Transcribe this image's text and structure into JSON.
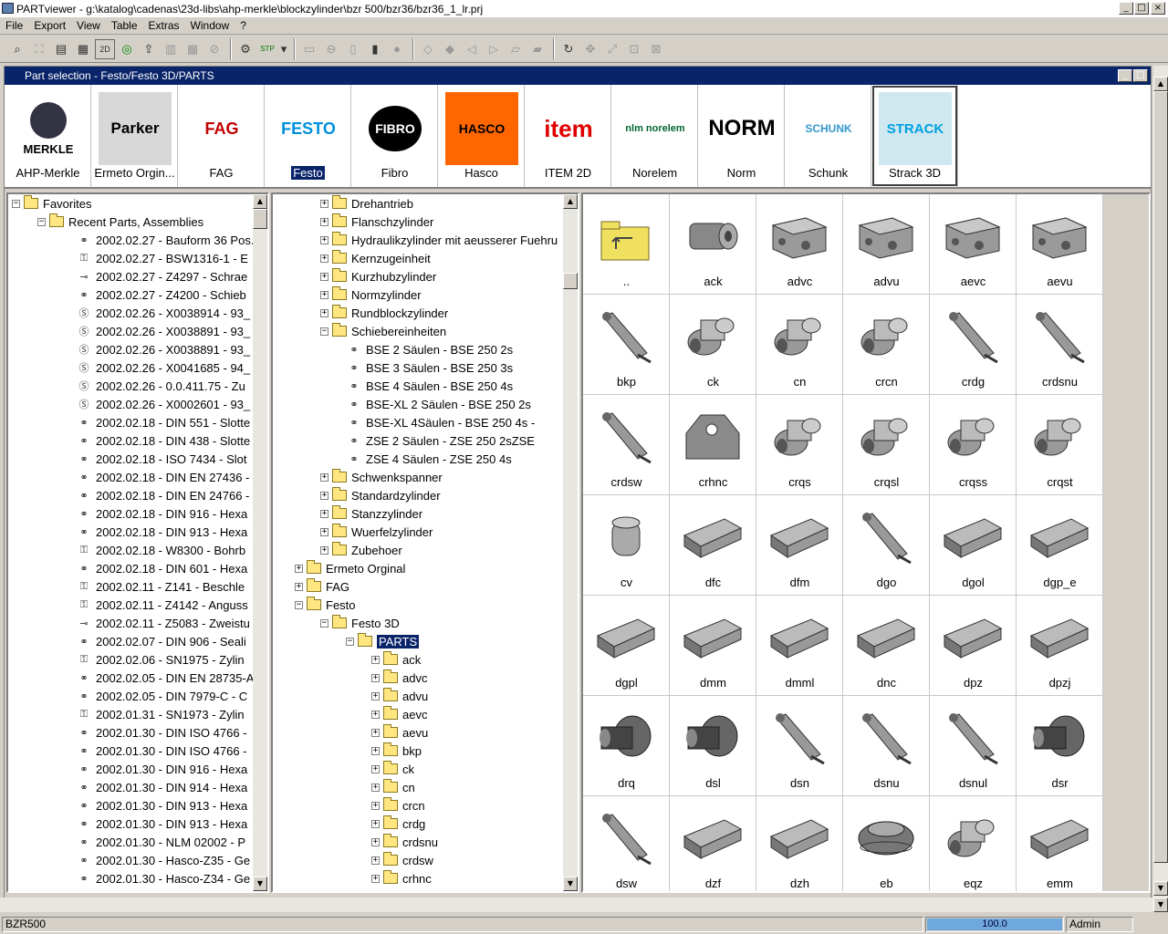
{
  "window": {
    "title": "PARTviewer - g:\\katalog\\cadenas\\23d-libs\\ahp-merkle\\blockzylinder\\bzr 500/bzr36/bzr36_1_lr.prj"
  },
  "menu": [
    "File",
    "Export",
    "View",
    "Table",
    "Extras",
    "Window",
    "?"
  ],
  "toolbar": {
    "icon_2d": "2D",
    "icon_stp": "STP"
  },
  "part_selection": {
    "title": "Part selection  -  Festo/Festo 3D/PARTS"
  },
  "catalogs": [
    {
      "label": "AHP-Merkle",
      "logo": "MERKLE",
      "color": "#000000"
    },
    {
      "label": "Ermeto Orgin...",
      "logo": "Parker",
      "color": "#000000"
    },
    {
      "label": "FAG",
      "logo": "FAG",
      "color": "#c00000"
    },
    {
      "label": "Festo",
      "logo": "FESTO",
      "color": "#0091dc"
    },
    {
      "label": "Fibro",
      "logo": "FIBRO",
      "color": "#000000"
    },
    {
      "label": "Hasco",
      "logo": "HASCO",
      "color": "#ff6600"
    },
    {
      "label": "ITEM 2D",
      "logo": "item",
      "color": "#e00000"
    },
    {
      "label": "Norelem",
      "logo": "nlm norelem",
      "color": "#006633"
    },
    {
      "label": "Norm",
      "logo": "NORM",
      "color": "#000000"
    },
    {
      "label": "Schunk",
      "logo": "SCHUNK",
      "color": "#3399cc"
    },
    {
      "label": "Strack 3D",
      "logo": "STRACK",
      "color": "#00a0e0"
    }
  ],
  "favorites": {
    "root": "Favorites",
    "recent": "Recent Parts, Assemblies",
    "items": [
      "2002.02.27 - Bauform 36 Pos.",
      "2002.02.27 - BSW1316-1  -  E",
      "2002.02.27 - Z4297  -  Schrae",
      "2002.02.27 - Z4200  -  Schieb",
      "2002.02.26 - X0038914  -  93_",
      "2002.02.26 - X0038891  -  93_",
      "2002.02.26 - X0038891  -  93_",
      "2002.02.26 - X0041685  -  94_",
      "2002.02.26 - 0.0.411.75  -  Zu",
      "2002.02.26 - X0002601  -  93_",
      "2002.02.18 - DIN 551  -  Slotte",
      "2002.02.18 - DIN 438  -  Slotte",
      "2002.02.18 - ISO 7434  -  Slot",
      "2002.02.18 - DIN EN 27436  -",
      "2002.02.18 - DIN EN 24766  -",
      "2002.02.18 - DIN 916  -  Hexa",
      "2002.02.18 - DIN 913  -  Hexa",
      "2002.02.18 - W8300  -  Bohrb",
      "2002.02.18 - DIN 601  -  Hexa",
      "2002.02.11 - Z141  -  Beschle",
      "2002.02.11 - Z4142  -  Anguss",
      "2002.02.11 - Z5083  -  Zweistu",
      "2002.02.07 - DIN 906  -  Seali",
      "2002.02.06 - SN1975  -  Zylin",
      "2002.02.05 - DIN EN 28735-A",
      "2002.02.05 - DIN 7979-C  -  C",
      "2002.01.31 - SN1973  -  Zylin",
      "2002.01.30 - DIN ISO 4766  -",
      "2002.01.30 - DIN ISO 4766  -",
      "2002.01.30 - DIN 916  -  Hexa",
      "2002.01.30 - DIN 914  -  Hexa",
      "2002.01.30 - DIN 913  -  Hexa",
      "2002.01.30 - DIN 913  -  Hexa",
      "2002.01.30 - NLM 02002  -  P",
      "2002.01.30 - Hasco-Z35  -  Ge",
      "2002.01.30 - Hasco-Z34  -  Ge"
    ]
  },
  "catalog_tree": [
    {
      "label": "Drehantrieb",
      "level": 2,
      "type": "folder",
      "exp": "+"
    },
    {
      "label": "Flanschzylinder",
      "level": 2,
      "type": "folder",
      "exp": "+"
    },
    {
      "label": "Hydraulikzylinder mit aeusserer Fuehru",
      "level": 2,
      "type": "folder",
      "exp": "+"
    },
    {
      "label": "Kernzugeinheit",
      "level": 2,
      "type": "folder",
      "exp": "+"
    },
    {
      "label": "Kurzhubzylinder",
      "level": 2,
      "type": "folder",
      "exp": "+"
    },
    {
      "label": "Normzylinder",
      "level": 2,
      "type": "folder",
      "exp": "+"
    },
    {
      "label": "Rundblockzylinder",
      "level": 2,
      "type": "folder",
      "exp": "+"
    },
    {
      "label": "Schiebereinheiten",
      "level": 2,
      "type": "folder",
      "exp": "-"
    },
    {
      "label": "BSE 2 Säulen  -  BSE 250 2s",
      "level": 3,
      "type": "part"
    },
    {
      "label": "BSE 3 Säulen  -  BSE 250 3s",
      "level": 3,
      "type": "part"
    },
    {
      "label": "BSE 4 Säulen  -  BSE 250 4s",
      "level": 3,
      "type": "part"
    },
    {
      "label": "BSE-XL 2 Säulen  -  BSE 250 2s",
      "level": 3,
      "type": "part"
    },
    {
      "label": "BSE-XL 4Säulen  -  BSE 250 4s -",
      "level": 3,
      "type": "part"
    },
    {
      "label": "ZSE 2 Säulen  -  ZSE 250 2sZSE",
      "level": 3,
      "type": "part"
    },
    {
      "label": "ZSE 4 Säulen  -  ZSE 250 4s",
      "level": 3,
      "type": "part"
    },
    {
      "label": "Schwenkspanner",
      "level": 2,
      "type": "folder",
      "exp": "+"
    },
    {
      "label": "Standardzylinder",
      "level": 2,
      "type": "folder",
      "exp": "+"
    },
    {
      "label": "Stanzzylinder",
      "level": 2,
      "type": "folder",
      "exp": "+"
    },
    {
      "label": "Wuerfelzylinder",
      "level": 2,
      "type": "folder",
      "exp": "+"
    },
    {
      "label": "Zubehoer",
      "level": 2,
      "type": "folder",
      "exp": "+"
    },
    {
      "label": "Ermeto Orginal",
      "level": 1,
      "type": "folder",
      "exp": "+"
    },
    {
      "label": "FAG",
      "level": 1,
      "type": "folder",
      "exp": "+"
    },
    {
      "label": "Festo",
      "level": 1,
      "type": "folder",
      "exp": "-"
    },
    {
      "label": "Festo 3D",
      "level": 2,
      "type": "folder",
      "exp": "-"
    },
    {
      "label": "PARTS",
      "level": 3,
      "type": "folder",
      "exp": "-",
      "selected": true
    },
    {
      "label": "ack",
      "level": 4,
      "type": "folder",
      "exp": "+"
    },
    {
      "label": "advc",
      "level": 4,
      "type": "folder",
      "exp": "+"
    },
    {
      "label": "advu",
      "level": 4,
      "type": "folder",
      "exp": "+"
    },
    {
      "label": "aevc",
      "level": 4,
      "type": "folder",
      "exp": "+"
    },
    {
      "label": "aevu",
      "level": 4,
      "type": "folder",
      "exp": "+"
    },
    {
      "label": "bkp",
      "level": 4,
      "type": "folder",
      "exp": "+"
    },
    {
      "label": "ck",
      "level": 4,
      "type": "folder",
      "exp": "+"
    },
    {
      "label": "cn",
      "level": 4,
      "type": "folder",
      "exp": "+"
    },
    {
      "label": "crcn",
      "level": 4,
      "type": "folder",
      "exp": "+"
    },
    {
      "label": "crdg",
      "level": 4,
      "type": "folder",
      "exp": "+"
    },
    {
      "label": "crdsnu",
      "level": 4,
      "type": "folder",
      "exp": "+"
    },
    {
      "label": "crdsw",
      "level": 4,
      "type": "folder",
      "exp": "+"
    },
    {
      "label": "crhnc",
      "level": 4,
      "type": "folder",
      "exp": "+"
    }
  ],
  "parts": [
    "..",
    "ack",
    "advc",
    "advu",
    "aevc",
    "aevu",
    "bkp",
    "ck",
    "cn",
    "crcn",
    "crdg",
    "crdsnu",
    "crdsw",
    "crhnc",
    "crqs",
    "crqsl",
    "crqss",
    "crqst",
    "cv",
    "dfc",
    "dfm",
    "dgo",
    "dgol",
    "dgp_e",
    "dgpl",
    "dmm",
    "dmml",
    "dnc",
    "dpz",
    "dpzj",
    "drq",
    "dsl",
    "dsn",
    "dsnu",
    "dsnul",
    "dsr",
    "dsw",
    "dzf",
    "dzh",
    "eb",
    "eqz",
    "emm"
  ],
  "status": {
    "left": "BZR500",
    "progress_text": "100.0",
    "progress": 1.0,
    "user": "Admin"
  }
}
